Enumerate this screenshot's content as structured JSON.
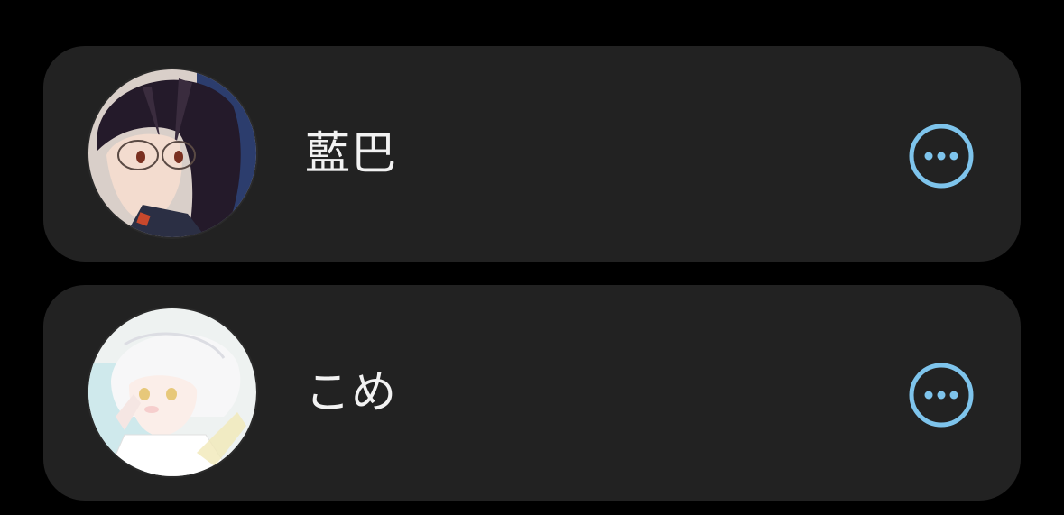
{
  "contacts": [
    {
      "name": "藍巴",
      "avatar": "avatar-dark-hair-glasses"
    },
    {
      "name": "こめ",
      "avatar": "avatar-white-hair"
    }
  ],
  "more_button": {
    "icon": "more-horizontal-circle-icon",
    "color": "#7ec4ec"
  },
  "colors": {
    "background": "#000000",
    "card": "#222222",
    "text": "#f2f2f2",
    "accent": "#7ec4ec"
  }
}
